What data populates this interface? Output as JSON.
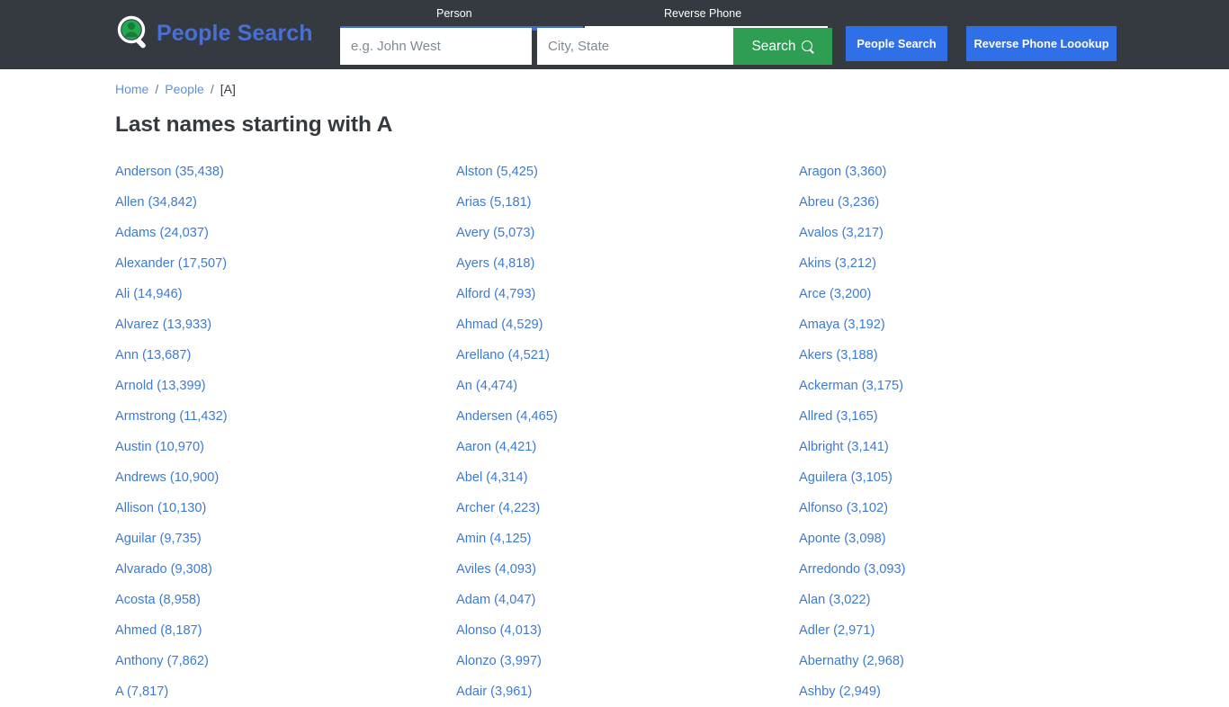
{
  "header": {
    "brand_name": "People Search",
    "brand_icon": "magnifier-person-icon",
    "tabs": [
      {
        "label": "Person",
        "active": true
      },
      {
        "label": "Reverse Phone",
        "active": false
      }
    ],
    "search": {
      "name_value": "",
      "name_placeholder": "e.g. John West",
      "city_value": "",
      "city_placeholder": "City, State",
      "submit_label": "Search",
      "submit_icon": "search-icon"
    },
    "actions": [
      {
        "label": "People Search"
      },
      {
        "label": "Reverse Phone Loookup"
      }
    ],
    "colors": {
      "background": "#343a40",
      "brand_text": "#4a6fd4",
      "tab_active_underline": "#3b6ed4",
      "tab_inactive_underline": "#ffffff",
      "submit_green": "#2e9e52",
      "nav_blue": "#2f6fe8"
    }
  },
  "breadcrumb": {
    "items": [
      {
        "label": "Home",
        "link": true
      },
      {
        "label": "People",
        "link": true
      },
      {
        "label": "[A]",
        "link": false
      }
    ],
    "separator": "/"
  },
  "main": {
    "title": "Last names starting with A",
    "link_color": "#3c7bd4",
    "columns": [
      {
        "items": [
          "Anderson (35,438)",
          "Allen (34,842)",
          "Adams (24,037)",
          "Alexander (17,507)",
          "Ali (14,946)",
          "Alvarez (13,933)",
          "Ann (13,687)",
          "Arnold (13,399)",
          "Armstrong (11,432)",
          "Austin (10,970)",
          "Andrews (10,900)",
          "Allison (10,130)",
          "Aguilar (9,735)",
          "Alvarado (9,308)",
          "Acosta (8,958)",
          "Ahmed (8,187)",
          "Anthony (7,862)",
          "A (7,817)"
        ]
      },
      {
        "items": [
          "Alston (5,425)",
          "Arias (5,181)",
          "Avery (5,073)",
          "Ayers (4,818)",
          "Alford (4,793)",
          "Ahmad (4,529)",
          "Arellano (4,521)",
          "An (4,474)",
          "Andersen (4,465)",
          "Aaron (4,421)",
          "Abel (4,314)",
          "Archer (4,223)",
          "Amin (4,125)",
          "Aviles (4,093)",
          "Adam (4,047)",
          "Alonso (4,013)",
          "Alonzo (3,997)",
          "Adair (3,961)"
        ]
      },
      {
        "items": [
          "Aragon (3,360)",
          "Abreu (3,236)",
          "Avalos (3,217)",
          "Akins (3,212)",
          "Arce (3,200)",
          "Amaya (3,192)",
          "Akers (3,188)",
          "Ackerman (3,175)",
          "Allred (3,165)",
          "Albright (3,141)",
          "Aguilera (3,105)",
          "Alfonso (3,102)",
          "Aponte (3,098)",
          "Arredondo (3,093)",
          "Alan (3,022)",
          "Adler (2,971)",
          "Abernathy (2,968)",
          "Ashby (2,949)"
        ]
      }
    ]
  }
}
